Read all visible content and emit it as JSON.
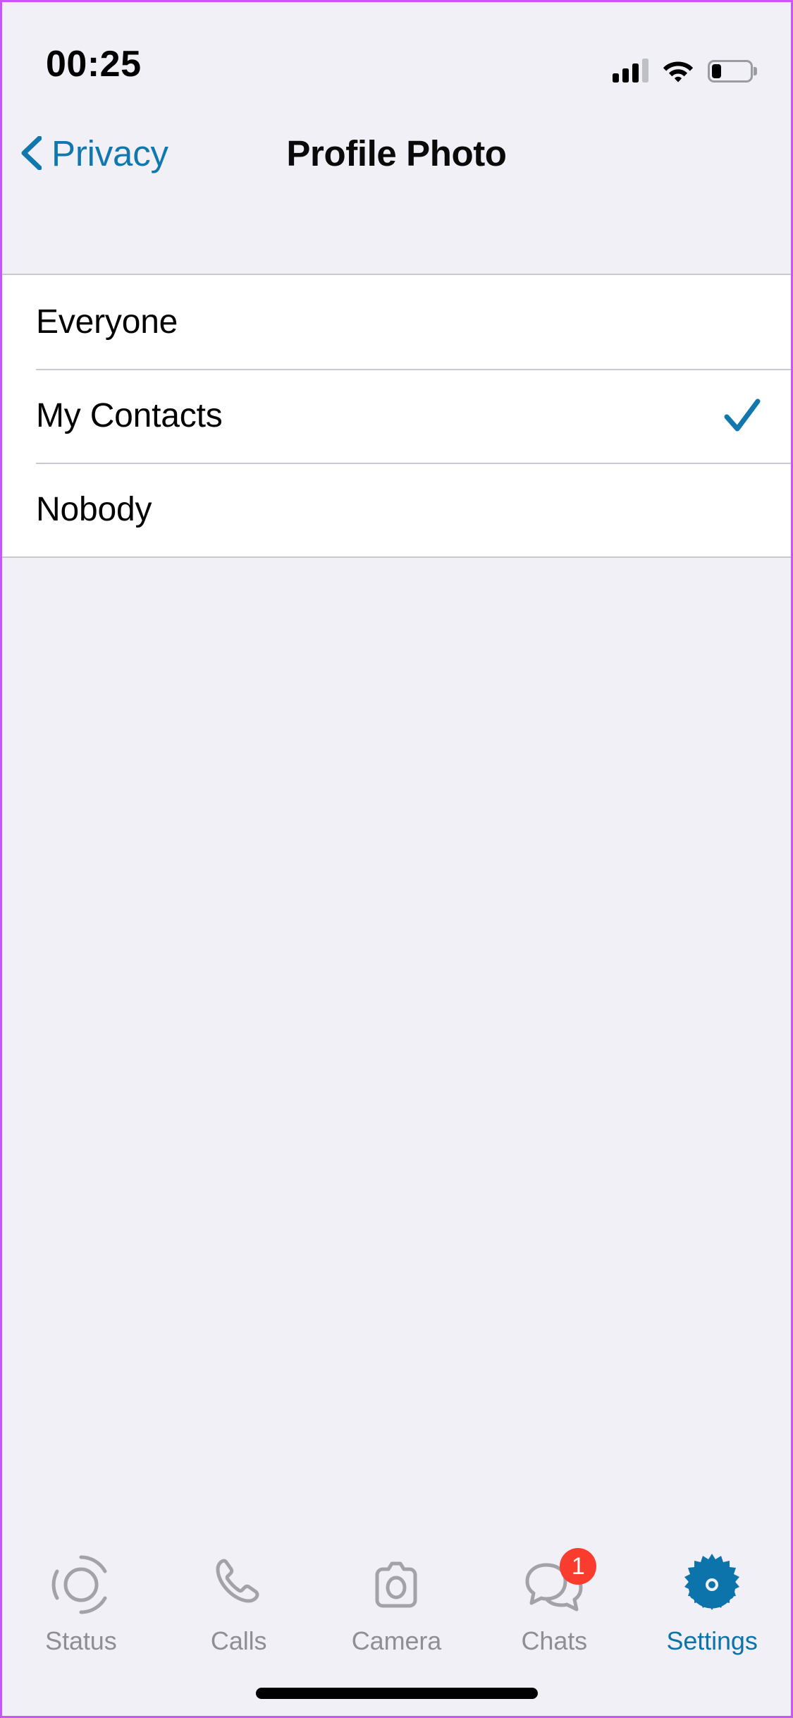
{
  "status_bar": {
    "time": "00:25",
    "cellular_icon": "cellular-signal-icon",
    "cellular_bars_filled": 3,
    "cellular_bars_total": 4,
    "wifi_icon": "wifi-icon",
    "battery_icon": "battery-icon",
    "battery_level_percent": 25
  },
  "nav_bar": {
    "back_icon": "chevron-left-icon",
    "back_label": "Privacy",
    "title": "Profile Photo",
    "accent_color": "#1178ad"
  },
  "options": {
    "items": [
      {
        "label": "Everyone",
        "selected": false
      },
      {
        "label": "My Contacts",
        "selected": true
      },
      {
        "label": "Nobody",
        "selected": false
      }
    ],
    "check_icon": "checkmark-icon",
    "check_color": "#1178ad"
  },
  "tab_bar": {
    "active_color": "#0c74ab",
    "inactive_color": "#8e8e94",
    "badge_color": "#fa3c2e",
    "tabs": [
      {
        "label": "Status",
        "icon": "status-rings-icon",
        "active": false,
        "badge": ""
      },
      {
        "label": "Calls",
        "icon": "phone-icon",
        "active": false,
        "badge": ""
      },
      {
        "label": "Camera",
        "icon": "camera-icon",
        "active": false,
        "badge": ""
      },
      {
        "label": "Chats",
        "icon": "chat-bubbles-icon",
        "active": false,
        "badge": "1"
      },
      {
        "label": "Settings",
        "icon": "gear-icon",
        "active": true,
        "badge": ""
      }
    ]
  },
  "home_indicator": {
    "icon": "home-indicator"
  }
}
